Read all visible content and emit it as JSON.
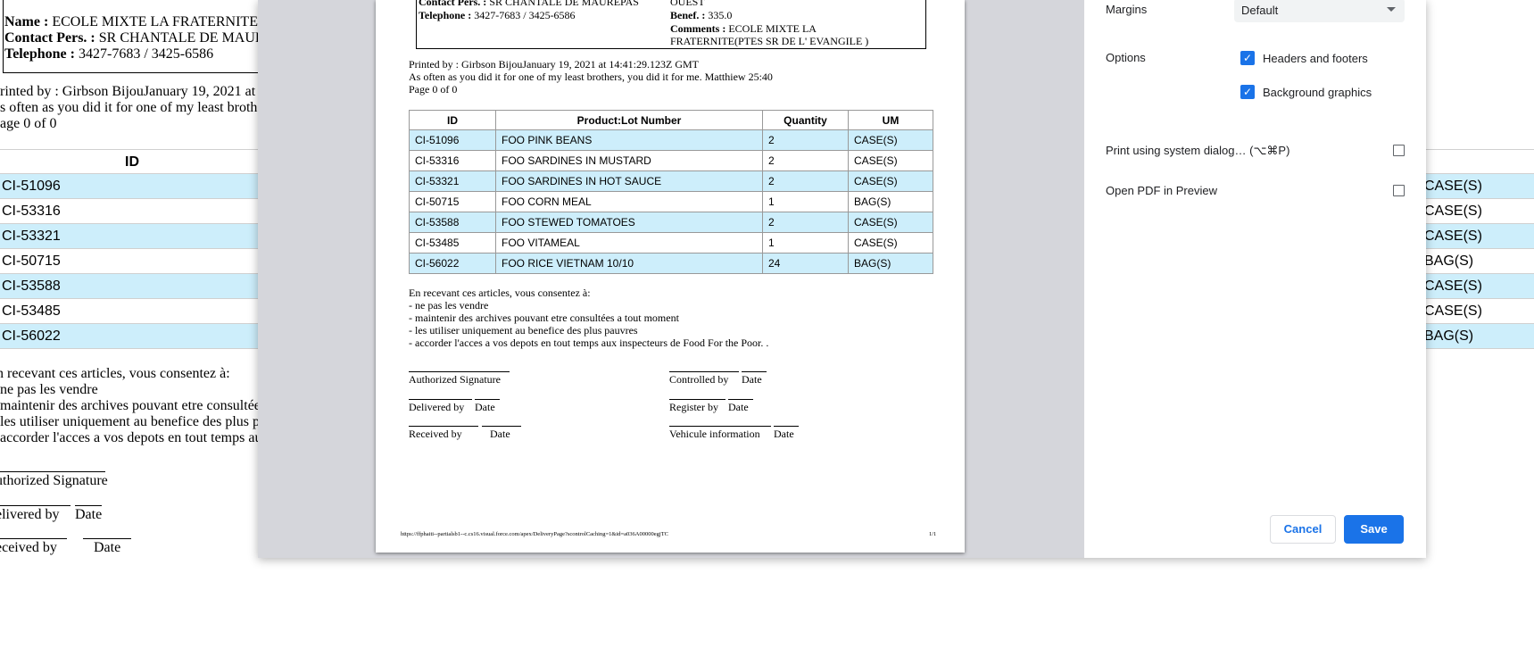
{
  "background_doc": {
    "name_label": "Name :",
    "name": "ECOLE MIXTE LA FRATERNITE(",
    "contact_label": "Contact Pers. :",
    "contact": "SR CHANTALE DE MAUF",
    "tel_label": "Telephone :",
    "tel": "3427-7683 / 3425-6586",
    "printed": "rinted by : Girbson BijouJanuary 19, 2021 at",
    "verse": "s often as you did it for one of my least broth",
    "page": "age 0 of 0",
    "id_header": "ID",
    "rows": [
      {
        "id": "CI-51096",
        "um": "CASE(S)"
      },
      {
        "id": "CI-53316",
        "um": "CASE(S)"
      },
      {
        "id": "CI-53321",
        "um": "CASE(S)"
      },
      {
        "id": "CI-50715",
        "um": "BAG(S)"
      },
      {
        "id": "CI-53588",
        "um": "CASE(S)"
      },
      {
        "id": "CI-53485",
        "um": "CASE(S)"
      },
      {
        "id": "CI-56022",
        "um": "BAG(S)"
      }
    ],
    "consent": [
      "n recevant ces articles, vous consentez à:",
      "ne pas les vendre",
      "maintenir des archives pouvant etre consultée",
      "les utiliser uniquement au benefice des plus p",
      "accorder l'acces a vos depots en tout temps au"
    ],
    "sig_authorized": "uthorized Signature",
    "sig_delivered": "elivered by",
    "sig_date1": "Date",
    "sig_received": "eceived by",
    "sig_date2": "Date"
  },
  "preview_page": {
    "contact_label": "Contact Pers. :",
    "contact": "SR CHANTALE DE MAUREPAS",
    "region": "OUEST",
    "tel_label": "Telephone :",
    "tel": "3427-7683 / 3425-6586",
    "benef_label": "Benef. :",
    "benef": "335.0",
    "comments_label": "Comments :",
    "comments1": "ECOLE MIXTE LA",
    "comments2": "FRATERNITE(PTES SR DE L' EVANGILE )",
    "printed": "Printed by : Girbson BijouJanuary 19, 2021 at 14:41:29.123Z   GMT",
    "verse": "As often as you did it for one of my least brothers, you did it for me. Matthiew 25:40",
    "page": "Page 0 of 0",
    "headers": [
      "ID",
      "Product:Lot Number",
      "Quantity",
      "UM"
    ],
    "rows": [
      [
        "CI-51096",
        "FOO PINK BEANS",
        "2",
        "CASE(S)"
      ],
      [
        "CI-53316",
        "FOO SARDINES IN MUSTARD",
        "2",
        "CASE(S)"
      ],
      [
        "CI-53321",
        "FOO SARDINES IN HOT SAUCE",
        "2",
        "CASE(S)"
      ],
      [
        "CI-50715",
        "FOO CORN MEAL",
        "1",
        "BAG(S)"
      ],
      [
        "CI-53588",
        "FOO STEWED TOMATOES",
        "2",
        "CASE(S)"
      ],
      [
        "CI-53485",
        "FOO VITAMEAL",
        "1",
        "CASE(S)"
      ],
      [
        "CI-56022",
        "FOO RICE VIETNAM 10/10",
        "24",
        "BAG(S)"
      ]
    ],
    "consent": [
      "En recevant ces articles, vous consentez à:",
      "- ne pas les vendre",
      "- maintenir des archives pouvant etre consultées a tout moment",
      "- les utiliser uniquement au benefice des plus pauvres",
      "- accorder l'acces a vos depots en tout temps aux inspecteurs de Food For the Poor. ."
    ],
    "sig": {
      "authorized": "Authorized Signature",
      "controlled": "Controlled by",
      "date": "Date",
      "delivered": "Delivered by",
      "register": "Register by",
      "received": "Received by",
      "vehicule": "Vehicule information"
    },
    "footer_url": "https://ffphaiti--partialsb1--c.cs16.visual.force.com/apex/DeliveryPage?scontrolCaching=1&id=a036A00000egjTC",
    "footer_page": "1/1"
  },
  "settings": {
    "margins_label": "Margins",
    "margins_value": "Default",
    "options_label": "Options",
    "opt_headers": "Headers and footers",
    "opt_bg": "Background graphics",
    "system_dialog": "Print using system dialog… (⌥⌘P)",
    "open_pdf": "Open PDF in Preview",
    "cancel": "Cancel",
    "save": "Save",
    "accent": "#1a73e8"
  }
}
